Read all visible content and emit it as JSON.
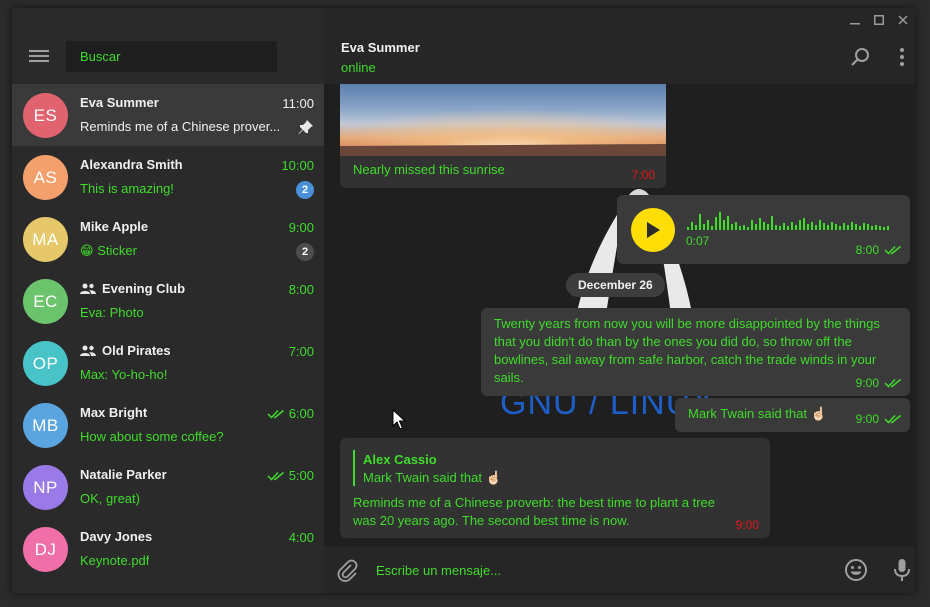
{
  "window": {
    "controls": [
      "minimize",
      "maximize",
      "close"
    ]
  },
  "sidebar": {
    "search_placeholder": "Buscar",
    "chats": [
      {
        "initials": "ES",
        "name": "Eva Summer",
        "time": "11:00",
        "preview": "Reminds me of a Chinese prover...",
        "color": "#e0636f",
        "pinned": true,
        "active": true,
        "group": false,
        "badge": "",
        "read_receipt": false
      },
      {
        "initials": "AS",
        "name": "Alexandra Smith",
        "time": "10:00",
        "preview": "This is amazing!",
        "color": "#f4a06c",
        "badge": "2",
        "badge_color": "#4a90d9",
        "group": false,
        "read_receipt": false
      },
      {
        "initials": "MA",
        "name": "Mike Apple",
        "time": "9:00",
        "preview": "Sticker",
        "preview_emoji": "😁",
        "color": "#e6c86b",
        "badge": "2",
        "badge_color": "#4d4d4d",
        "group": false,
        "read_receipt": false
      },
      {
        "initials": "EC",
        "name": "Evening Club",
        "time": "8:00",
        "preview": "Eva: Photo",
        "color": "#6bc46b",
        "group": true,
        "badge": "",
        "read_receipt": false
      },
      {
        "initials": "OP",
        "name": "Old Pirates",
        "time": "7:00",
        "preview": "Max: Yo-ho-ho!",
        "color": "#48c3c7",
        "group": true,
        "badge": "",
        "read_receipt": false
      },
      {
        "initials": "MB",
        "name": "Max Bright",
        "time": "6:00",
        "preview": "How about some coffee?",
        "color": "#5aa4e0",
        "group": false,
        "badge": "",
        "read_receipt": true
      },
      {
        "initials": "NP",
        "name": "Natalie Parker",
        "time": "5:00",
        "preview": "OK, great)",
        "color": "#9a7ae8",
        "group": false,
        "badge": "",
        "read_receipt": true
      },
      {
        "initials": "DJ",
        "name": "Davy Jones",
        "time": "4:00",
        "preview": "Keynote.pdf",
        "color": "#f06fa8",
        "group": false,
        "badge": "",
        "read_receipt": false
      }
    ]
  },
  "header": {
    "name": "Eva Summer",
    "status": "online"
  },
  "messages": {
    "photo": {
      "caption": "Nearly missed this sunrise",
      "time": "7:00"
    },
    "voice": {
      "duration": "0:07",
      "time": "8:00"
    },
    "date": "December 26",
    "quote": {
      "text": "Twenty years from now you will be more disappointed by the things that you didn't do than by the ones you did do, so throw off the bowlines, sail away from safe harbor, catch the trade winds in your sails.",
      "time": "9:00"
    },
    "attribution": {
      "text": "Mark Twain said that ☝🏻",
      "time": "9:00"
    },
    "reply": {
      "author": "Alex Cassio",
      "quoted": "Mark Twain said that ☝🏻",
      "text": "Reminds me of a Chinese proverb: the best time to plant a tree was 20 years ago. The second best time is now.",
      "time": "9:00"
    },
    "background_text": "GNU / LINUX"
  },
  "composer": {
    "placeholder": "Escribe un mensaje..."
  },
  "colors": {
    "accent": "#3fdc2a",
    "error_time": "#e01818",
    "play_button": "#ffde05"
  }
}
